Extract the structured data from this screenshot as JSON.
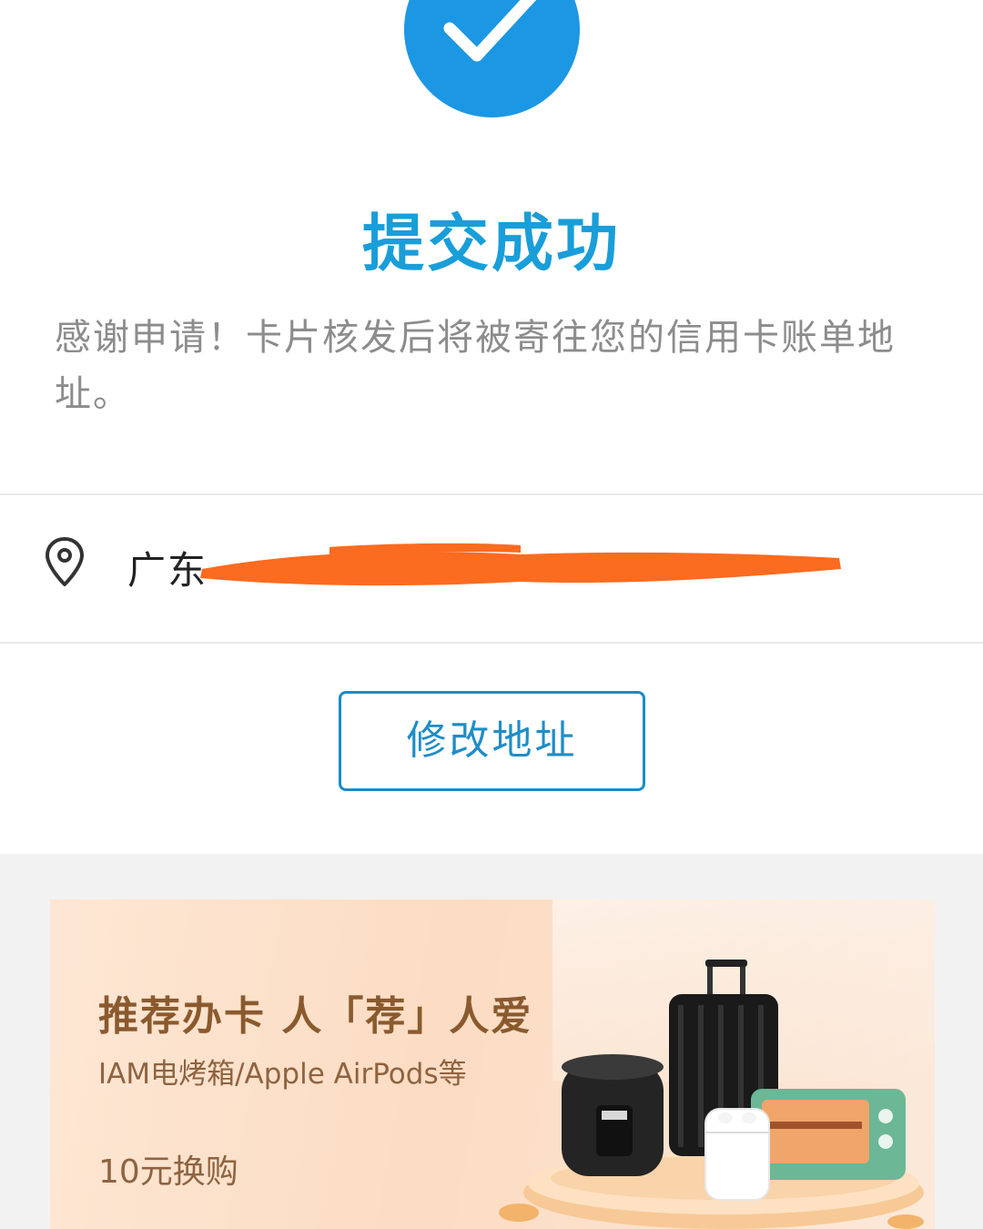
{
  "success": {
    "icon": "check-icon",
    "title": "提交成功",
    "description": "感谢申请！卡片核发后将被寄往您的信用卡账单地址。",
    "color": "#1c97e4"
  },
  "address": {
    "icon": "location-pin-icon",
    "visible_text": "广东",
    "redacted": true,
    "redaction_color": "#fb6b20"
  },
  "actions": {
    "modify_address": "修改地址",
    "accent": "#1a8cc7"
  },
  "promo": {
    "title": "推荐办卡 人「荐」人爱",
    "subtitle": "IAM电烤箱/Apple AirPods等",
    "price": "10元换购",
    "products": [
      "rice-cooker",
      "suitcase",
      "airpods",
      "toaster-oven"
    ]
  }
}
